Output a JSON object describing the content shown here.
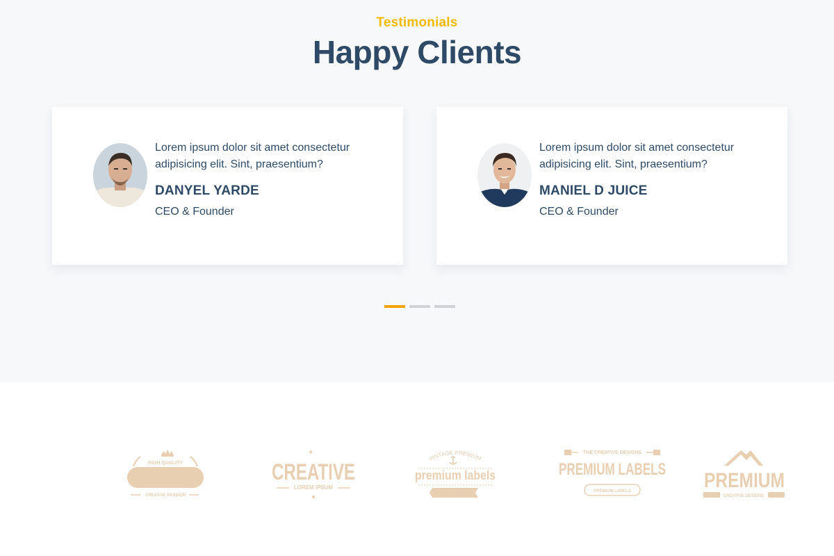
{
  "section": {
    "eyebrow": "Testimonials",
    "title": "Happy Clients"
  },
  "testimonials": [
    {
      "quote": "Lorem ipsum dolor sit amet consectetur adipisicing elit. Sint, praesentium?",
      "name": "DANYEL YARDE",
      "role": "CEO & Founder"
    },
    {
      "quote": "Lorem ipsum dolor sit amet consectetur adipisicing elit. Sint, praesentium?",
      "name": "MANIEL D JUICE",
      "role": "CEO & Founder"
    }
  ],
  "carousel": {
    "total_pages": 3,
    "active_page": 1
  },
  "logos": [
    {
      "top_text": "HIGH QUALITY",
      "bottom_text": "CREATIVE PASSION",
      "icon": "crown-icon"
    },
    {
      "main_text": "CREATIVE",
      "sub_text": "LOREM IPSUM"
    },
    {
      "top_text": "VINTAGE PREMIUM",
      "main_text": "premium labels",
      "icon": "anchor-icon"
    },
    {
      "top_text": "THE CREATIVE DESIGNS",
      "main_text": "PREMIUM LABELS",
      "badge_text": "PREMIUM LABELS"
    },
    {
      "main_text": "PREMIUM",
      "sub_text": "CREATIVE DESIGNS",
      "icon": "mountain-icon"
    }
  ],
  "colors": {
    "accent": "#f6b900",
    "active_dot": "#f6a300",
    "heading": "#2e4a66",
    "logo_tint": "#e8cfb2",
    "section_bg": "#f7f8fa"
  }
}
